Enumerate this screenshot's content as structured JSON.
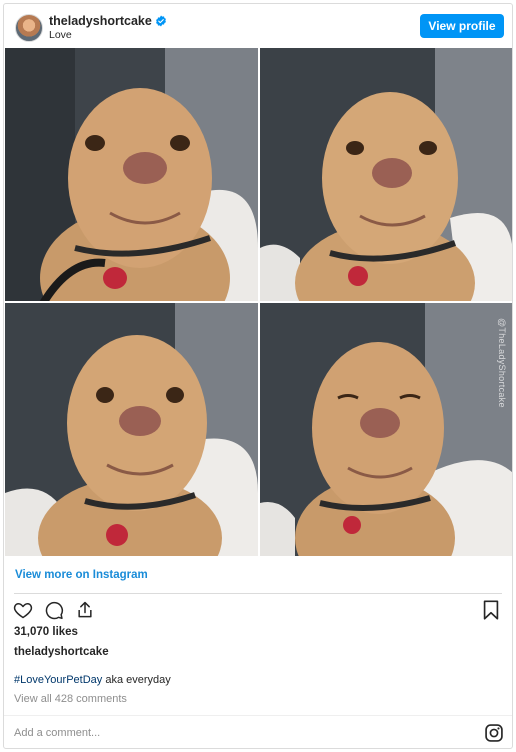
{
  "header": {
    "username": "theladyshortcake",
    "location": "Love",
    "view_profile_label": "View profile"
  },
  "photo": {
    "watermark": "@TheLadyShortcake"
  },
  "view_more_label": "View more on Instagram",
  "actions": {
    "icons": [
      "heart-icon",
      "comment-icon",
      "share-icon",
      "bookmark-icon"
    ]
  },
  "likes": "31,070 likes",
  "caption": {
    "username": "theladyshortcake",
    "hashtag": "#LoveYourPetDay",
    "text": " aka everyday"
  },
  "comments_label": "View all 428 comments",
  "add_comment_placeholder": "Add a comment...",
  "colors": {
    "accent": "#0095f6",
    "link": "#1a8cd8",
    "hashtag": "#00376b",
    "muted": "#8e8e8e"
  }
}
